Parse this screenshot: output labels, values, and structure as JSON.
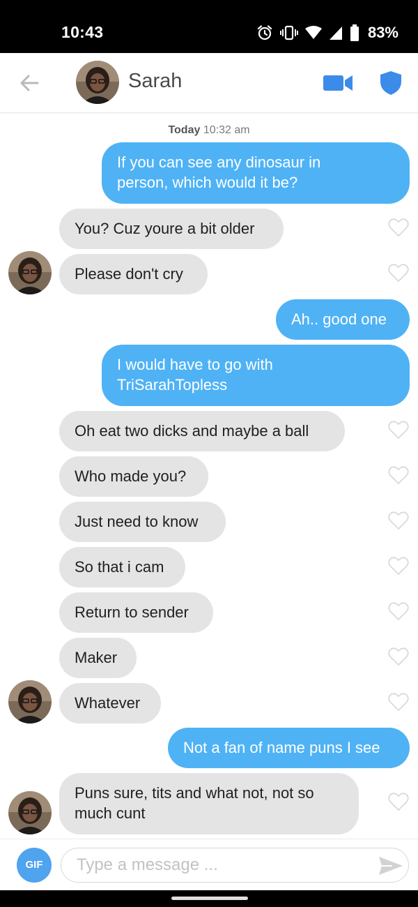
{
  "status_bar": {
    "time": "10:43",
    "battery": "83%",
    "icons": [
      "alarm-icon",
      "vibrate-icon",
      "wifi-icon",
      "signal-icon",
      "battery-icon"
    ]
  },
  "header": {
    "back_icon": "back-arrow-icon",
    "contact_name": "Sarah",
    "video_icon": "video-camera-icon",
    "safety_icon": "shield-icon"
  },
  "conversation": {
    "timestamp_day": "Today",
    "timestamp_time": "10:32 am",
    "messages": [
      {
        "dir": "out",
        "text": "If you can see any dinosaur in\nperson, which would it be?"
      },
      {
        "dir": "in",
        "text": "You? Cuz youre a bit older"
      },
      {
        "dir": "in",
        "text": "Please don't cry"
      },
      {
        "dir": "out",
        "text": "Ah.. good one"
      },
      {
        "dir": "out",
        "text": "I would have to go with\nTriSarahTopless"
      },
      {
        "dir": "in",
        "text": "Oh eat two dicks and maybe a ball"
      },
      {
        "dir": "in",
        "text": "Who made you?"
      },
      {
        "dir": "in",
        "text": "Just need to know"
      },
      {
        "dir": "in",
        "text": "So that i cam"
      },
      {
        "dir": "in",
        "text": "Return to sender"
      },
      {
        "dir": "in",
        "text": "Maker"
      },
      {
        "dir": "in",
        "text": "Whatever"
      },
      {
        "dir": "out",
        "text": "Not a fan of name puns I see"
      },
      {
        "dir": "in",
        "text": "Puns sure, tits and what not, not so\nmuch cunt"
      }
    ]
  },
  "composer": {
    "gif_label": "GIF",
    "placeholder": "Type a message ...",
    "value": "",
    "send_icon": "send-icon"
  },
  "colors": {
    "outgoing_bubble": "#4fb2f5",
    "incoming_bubble": "#e4e4e4",
    "accent_blue": "#3d8be8",
    "gif_button": "#4fa3ef"
  }
}
